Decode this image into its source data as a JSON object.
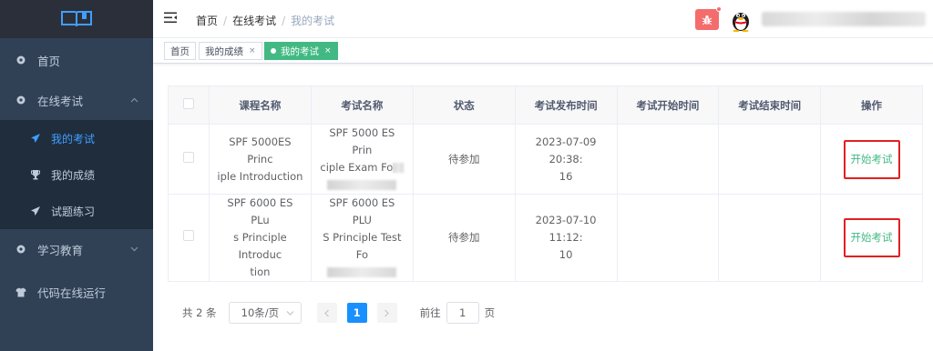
{
  "sidebar": {
    "logo_icon": "book-icon",
    "items": [
      {
        "label": "首页",
        "icon": "home-icon"
      },
      {
        "label": "在线考试",
        "icon": "exam-icon",
        "expanded": true,
        "children": [
          {
            "label": "我的考试",
            "icon": "paper-plane-icon",
            "active": true
          },
          {
            "label": "我的成绩",
            "icon": "trophy-icon"
          },
          {
            "label": "试题练习",
            "icon": "paper-plane-icon"
          }
        ]
      },
      {
        "label": "学习教育",
        "icon": "study-icon",
        "expanded": false
      },
      {
        "label": "代码在线运行",
        "icon": "shirt-icon"
      }
    ],
    "bg_color": "#304156",
    "active_color": "#409eff"
  },
  "navbar": {
    "breadcrumb": [
      "首页",
      "在线考试",
      "我的考试"
    ],
    "bug_icon": "bug-icon",
    "avatar_icon": "qq-penguin-icon"
  },
  "tags": [
    {
      "label": "首页",
      "closable": false,
      "active": false
    },
    {
      "label": "我的成绩",
      "closable": true,
      "active": false
    },
    {
      "label": "我的考试",
      "closable": true,
      "active": true
    }
  ],
  "tag_close": "×",
  "table": {
    "headers": [
      "课程名称",
      "考试名称",
      "状态",
      "考试发布时间",
      "考试开始时间",
      "考试结束时间",
      "操作"
    ],
    "rows": [
      {
        "course": "SPF 5000ES Principle Introduction",
        "course_lines": [
          "SPF 5000ES Princ",
          "iple Introduction"
        ],
        "exam_lines": [
          "SPF 5000 ES Prin",
          "ciple Exam Fo"
        ],
        "status": "待参加",
        "publish_lines": [
          "2023-07-09 20:38:",
          "16"
        ],
        "start": "",
        "end": "",
        "action": "开始考试"
      },
      {
        "course": "SPF 6000 ES PLus Principle Introduction",
        "course_lines": [
          "SPF 6000 ES PLu",
          "s Principle Introduc",
          "tion"
        ],
        "exam_lines": [
          "SPF 6000 ES PLU",
          "S Principle Test Fo"
        ],
        "status": "待参加",
        "publish_lines": [
          "2023-07-10 11:12:",
          "10"
        ],
        "start": "",
        "end": "",
        "action": "开始考试"
      }
    ],
    "action_color": "#42b983"
  },
  "pagination": {
    "total_text": "共 2 条",
    "page_size": "10条/页",
    "current_page": "1",
    "goto_label": "前往",
    "goto_value": "1",
    "page_suffix": "页",
    "prev_icon": "chevron-left-icon",
    "next_icon": "chevron-right-icon",
    "active_color": "#1890ff"
  }
}
